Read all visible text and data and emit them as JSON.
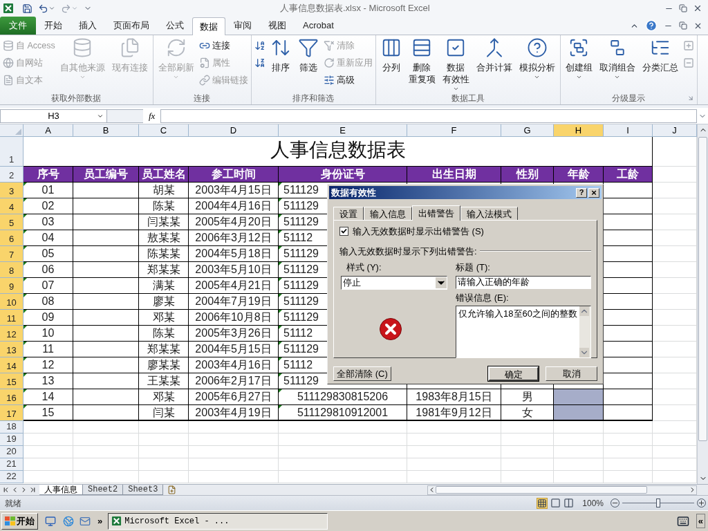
{
  "title_bar": {
    "title": "人事信息数据表.xlsx - Microsoft Excel"
  },
  "ribbon_tabs": [
    {
      "label": "文件",
      "kind": "file",
      "selected": false
    },
    {
      "label": "开始",
      "kind": "tab",
      "selected": false
    },
    {
      "label": "插入",
      "kind": "tab",
      "selected": false
    },
    {
      "label": "页面布局",
      "kind": "tab",
      "selected": false
    },
    {
      "label": "公式",
      "kind": "tab",
      "selected": false
    },
    {
      "label": "数据",
      "kind": "tab",
      "selected": true
    },
    {
      "label": "审阅",
      "kind": "tab",
      "selected": false
    },
    {
      "label": "视图",
      "kind": "tab",
      "selected": false
    },
    {
      "label": "Acrobat",
      "kind": "tab",
      "selected": false
    }
  ],
  "ribbon_groups": [
    {
      "label": "获取外部数据",
      "items": [
        {
          "kind": "stack",
          "buttons": [
            {
              "label": "自 Access",
              "disabled": true
            },
            {
              "label": "自网站",
              "disabled": true
            },
            {
              "label": "自文本",
              "disabled": true
            }
          ]
        },
        {
          "kind": "large",
          "lines": [
            "自其他来源"
          ],
          "dropdown": true,
          "disabled": true
        },
        {
          "kind": "large",
          "lines": [
            "现有连接"
          ],
          "disabled": true
        }
      ]
    },
    {
      "label": "连接",
      "items": [
        {
          "kind": "large",
          "lines": [
            "全部刷新"
          ],
          "dropdown": true,
          "disabled": true
        },
        {
          "kind": "stack",
          "buttons": [
            {
              "label": "连接",
              "disabled": false
            },
            {
              "label": "属性",
              "disabled": true
            },
            {
              "label": "编辑链接",
              "disabled": true
            }
          ]
        }
      ]
    },
    {
      "label": "排序和筛选",
      "items": [
        {
          "kind": "stack",
          "buttons": [
            {
              "disabled": false
            },
            {
              "disabled": false
            }
          ]
        },
        {
          "kind": "large",
          "lines": [
            "排序"
          ],
          "disabled": false
        },
        {
          "kind": "large",
          "lines": [
            "筛选"
          ],
          "disabled": false
        },
        {
          "kind": "stack",
          "buttons": [
            {
              "label": "清除",
              "disabled": true
            },
            {
              "label": "重新应用",
              "disabled": true
            },
            {
              "label": "高级",
              "disabled": false
            }
          ]
        }
      ]
    },
    {
      "label": "数据工具",
      "items": [
        {
          "kind": "large",
          "lines": [
            "分列"
          ],
          "disabled": false
        },
        {
          "kind": "large",
          "lines": [
            "删除",
            "重复项"
          ],
          "disabled": false
        },
        {
          "kind": "large",
          "lines": [
            "数据",
            "有效性"
          ],
          "dropdown": true,
          "disabled": false
        },
        {
          "kind": "large",
          "lines": [
            "合并计算"
          ],
          "disabled": false
        },
        {
          "kind": "large",
          "lines": [
            "模拟分析"
          ],
          "dropdown": true,
          "disabled": false
        }
      ]
    },
    {
      "label": "分级显示",
      "launcher": true,
      "items": [
        {
          "kind": "large",
          "lines": [
            "创建组"
          ],
          "dropdown": true,
          "disabled": false
        },
        {
          "kind": "large",
          "lines": [
            "取消组合"
          ],
          "dropdown": true,
          "disabled": false
        },
        {
          "kind": "large",
          "lines": [
            "分类汇总"
          ],
          "disabled": false
        },
        {
          "kind": "stack",
          "buttons": [
            {
              "disabled": true
            },
            {
              "disabled": true
            }
          ]
        }
      ]
    }
  ],
  "formula_bar": {
    "name_box": "H3",
    "fx": "fx"
  },
  "columns": [
    {
      "label": "A",
      "selected": false
    },
    {
      "label": "B",
      "selected": false
    },
    {
      "label": "C",
      "selected": false
    },
    {
      "label": "D",
      "selected": false
    },
    {
      "label": "E",
      "selected": false
    },
    {
      "label": "F",
      "selected": false
    },
    {
      "label": "G",
      "selected": false
    },
    {
      "label": "H",
      "selected": true
    },
    {
      "label": "I",
      "selected": false
    },
    {
      "label": "J",
      "selected": false
    }
  ],
  "row_headers": [
    {
      "label": "1",
      "selected": false
    },
    {
      "label": "2",
      "selected": false
    },
    {
      "label": "3",
      "selected": true
    },
    {
      "label": "4",
      "selected": true
    },
    {
      "label": "5",
      "selected": true
    },
    {
      "label": "6",
      "selected": true
    },
    {
      "label": "7",
      "selected": true
    },
    {
      "label": "8",
      "selected": true
    },
    {
      "label": "9",
      "selected": true
    },
    {
      "label": "10",
      "selected": true
    },
    {
      "label": "11",
      "selected": true
    },
    {
      "label": "12",
      "selected": true
    },
    {
      "label": "13",
      "selected": true
    },
    {
      "label": "14",
      "selected": true
    },
    {
      "label": "15",
      "selected": true
    },
    {
      "label": "16",
      "selected": true
    },
    {
      "label": "17",
      "selected": true
    },
    {
      "label": "18",
      "selected": false
    },
    {
      "label": "19",
      "selected": false
    },
    {
      "label": "20",
      "selected": false
    },
    {
      "label": "21",
      "selected": false
    },
    {
      "label": "22",
      "selected": false
    }
  ],
  "sheet_title": "人事信息数据表",
  "header_row": [
    "序号",
    "员工编号",
    "员工姓名",
    "参工时间",
    "身份证号",
    "出生日期",
    "性别",
    "年龄",
    "工龄"
  ],
  "rows": [
    {
      "no": "01",
      "name": "胡某",
      "join_date": "2003年4月15日",
      "id": "511129",
      "id_cut": true
    },
    {
      "no": "02",
      "name": "陈某",
      "join_date": "2004年4月16日",
      "id": "511129",
      "id_cut": true
    },
    {
      "no": "03",
      "name": "闫某某",
      "join_date": "2005年4月20日",
      "id": "511129",
      "id_cut": true
    },
    {
      "no": "04",
      "name": "敖某某",
      "join_date": "2006年3月12日",
      "id": "51112",
      "id_cut": true
    },
    {
      "no": "05",
      "name": "陈某某",
      "join_date": "2004年5月18日",
      "id": "511129",
      "id_cut": true
    },
    {
      "no": "06",
      "name": "郑某某",
      "join_date": "2003年5月10日",
      "id": "511129",
      "id_cut": true
    },
    {
      "no": "07",
      "name": "满某",
      "join_date": "2005年4月21日",
      "id": "511129",
      "id_cut": true
    },
    {
      "no": "08",
      "name": "廖某",
      "join_date": "2004年7月19日",
      "id": "511129",
      "id_cut": true
    },
    {
      "no": "09",
      "name": "邓某",
      "join_date": "2006年10月8日",
      "id": "511129",
      "id_cut": true
    },
    {
      "no": "10",
      "name": "陈某",
      "join_date": "2005年3月26日",
      "id": "51112",
      "id_cut": true
    },
    {
      "no": "11",
      "name": "郑某某",
      "join_date": "2004年5月15日",
      "id": "511129",
      "id_cut": true
    },
    {
      "no": "12",
      "name": "廖某某",
      "join_date": "2003年4月16日",
      "id": "51112",
      "id_cut": true
    },
    {
      "no": "13",
      "name": "王某某",
      "join_date": "2006年2月17日",
      "id": "511129",
      "id_cut": true
    },
    {
      "no": "14",
      "name": "邓某",
      "join_date": "2005年6月27日",
      "id": "511129830815206",
      "id_cut": false,
      "birth": "1983年8月15日",
      "sex": "男",
      "age_selected": true
    },
    {
      "no": "15",
      "name": "闫某",
      "join_date": "2003年4月19日",
      "id": "511129810912001",
      "id_cut": false,
      "birth": "1981年9月12日",
      "sex": "女",
      "age_selected": true
    }
  ],
  "dialog": {
    "title": "数据有效性",
    "help_button": "?",
    "close_button": "×",
    "tabs": [
      {
        "label": "设置",
        "selected": false
      },
      {
        "label": "输入信息",
        "selected": false
      },
      {
        "label": "出错警告",
        "selected": true
      },
      {
        "label": "输入法模式",
        "selected": false
      }
    ],
    "show_alert": {
      "label": "输入无效数据时显示出错警告 (S)",
      "checked": true
    },
    "section_label": "输入无效数据时显示下列出错警告:",
    "style_label": "样式 (Y):",
    "style_value": "停止",
    "title_label": "标题 (T):",
    "title_value": "请输入正确的年龄",
    "message_label": "错误信息 (E):",
    "message_value": "仅允许输入18至60之间的整数",
    "buttons": [
      {
        "label": "全部清除 (C)",
        "kind": "clear"
      },
      {
        "label": "确定",
        "kind": "ok"
      },
      {
        "label": "取消",
        "kind": "cancel"
      }
    ]
  },
  "sheet_tabs": [
    {
      "label": "人事信息",
      "selected": true
    },
    {
      "label": "Sheet2",
      "selected": false
    },
    {
      "label": "Sheet3",
      "selected": false
    }
  ],
  "status_bar": {
    "status": "就绪",
    "zoom": "100%",
    "zoom_slider": {
      "level": 0.5
    }
  },
  "taskbar": {
    "start": "开始",
    "more": "»",
    "task": "Microsoft Excel - ...",
    "collapse": "«"
  }
}
